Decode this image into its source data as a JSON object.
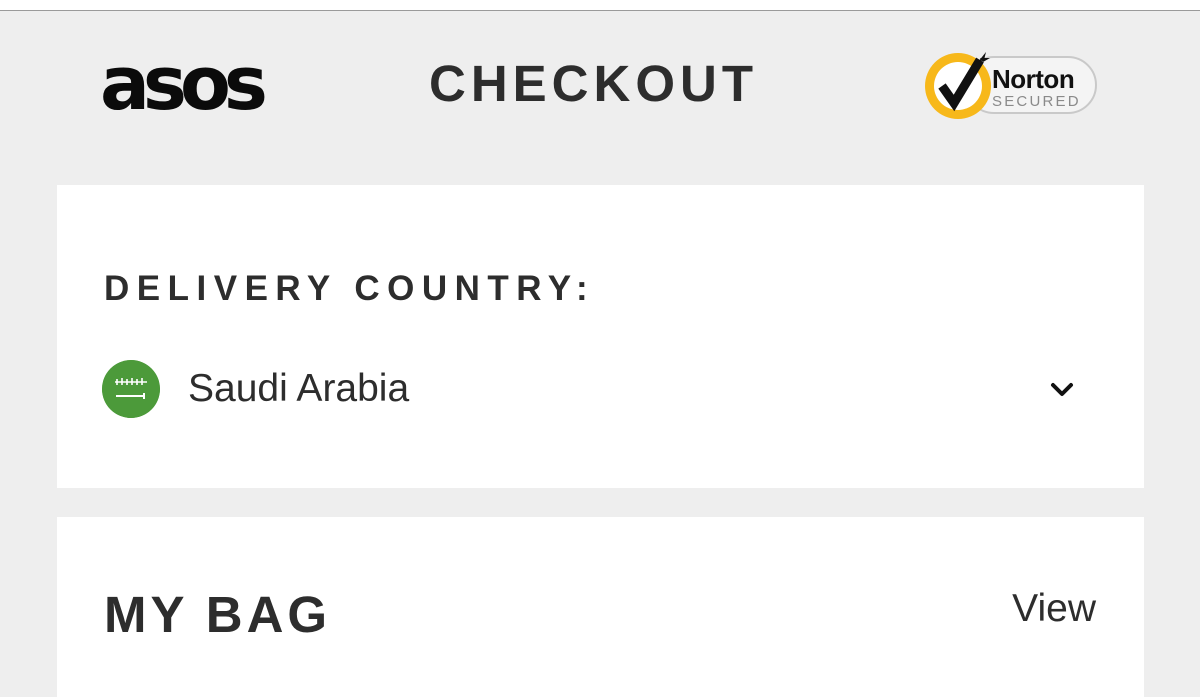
{
  "header": {
    "logo_text": "asos",
    "title": "CHECKOUT",
    "badge": {
      "name": "Norton",
      "subtitle": "SECURED",
      "icon": "checkmark-icon",
      "accent_color": "#f7b81a"
    }
  },
  "delivery": {
    "label": "DELIVERY COUNTRY:",
    "selected_country": "Saudi Arabia",
    "flag_icon": "saudi-arabia-flag-icon",
    "flag_color": "#4c9a3a",
    "dropdown_icon": "chevron-down-icon"
  },
  "bag": {
    "title": "MY BAG",
    "view_label": "View"
  }
}
